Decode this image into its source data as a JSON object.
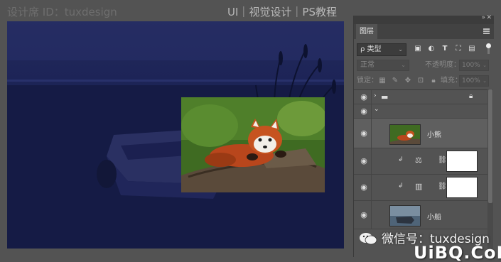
{
  "title_left": "设计席 ID：tuxdesign",
  "title_right": "UI｜视觉设计｜PS教程",
  "panel": {
    "tab_label": "图层",
    "filter_select": "ρ 类型",
    "blend_mode": "正常",
    "opacity_label": "不透明度：",
    "opacity_value": "100%",
    "lock_label": "锁定：",
    "fill_label": "填充：",
    "fill_value": "100%",
    "icons": {
      "filter": [
        "image-filter-icon",
        "adjustment-filter-icon",
        "type-filter-icon",
        "shape-filter-icon",
        "smart-object-filter-icon"
      ],
      "lock": [
        "lock-pixels-icon",
        "lock-image-icon",
        "lock-position-icon",
        "lock-artboard-icon",
        "lock-all-icon"
      ]
    }
  },
  "layers": [
    {
      "type": "group",
      "name": "",
      "locked": true
    },
    {
      "type": "expanded-group",
      "name": ""
    },
    {
      "type": "pixel",
      "name": "小熊",
      "thumb": "red-panda"
    },
    {
      "type": "adjustment",
      "name": "",
      "adj_icon": "balance-icon"
    },
    {
      "type": "adjustment",
      "name": "",
      "adj_icon": "levels-icon"
    },
    {
      "type": "pixel",
      "name": "小船",
      "thumb": "boat"
    }
  ],
  "watermarks": {
    "wechat": "微信号：tuxdesign",
    "site": "UiBQ.CoM"
  }
}
